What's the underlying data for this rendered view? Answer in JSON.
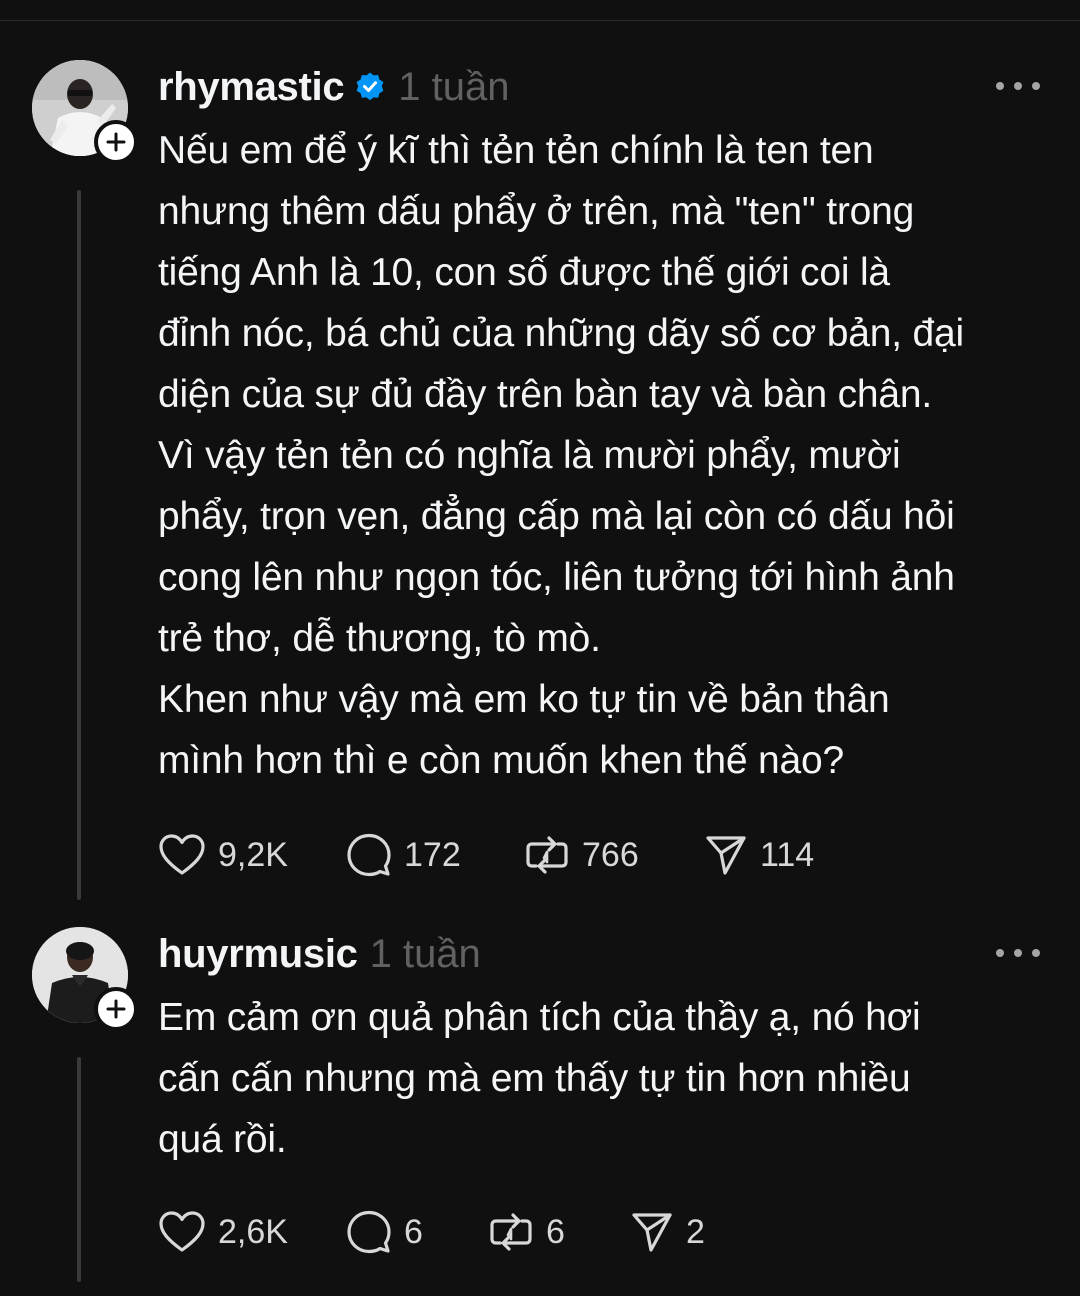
{
  "posts": [
    {
      "username": "rhymastic",
      "verified": true,
      "timestamp": "1 tuần",
      "text": "Nếu em để ý kĩ thì tẻn tẻn chính là ten ten\nnhưng thêm dấu phẩy ở trên, mà \"ten\" trong\ntiếng Anh là 10, con số được thế giới coi là\nđỉnh nóc, bá chủ của những dãy số cơ bản, đại\ndiện của sự đủ đầy trên bàn tay và bàn chân.\nVì vậy tẻn tẻn có nghĩa là mười phẩy, mười\nphẩy, trọn vẹn, đẳng cấp mà lại còn có dấu hỏi\ncong lên như ngọn tóc, liên tưởng tới hình ảnh\ntrẻ thơ, dễ thương, tò mò.\nKhen như vậy mà em ko tự tin về bản thân\nmình hơn thì e còn muốn khen thế nào?",
      "likes": "9,2K",
      "replies": "172",
      "reposts": "766",
      "shares": "114"
    },
    {
      "username": "huyrmusic",
      "verified": false,
      "timestamp": "1 tuần",
      "text": "Em cảm ơn quả phân tích của thầy ạ, nó hơi\ncấn cấn nhưng mà em thấy tự tin hơn nhiều\nquá rồi.",
      "likes": "2,6K",
      "replies": "6",
      "reposts": "6",
      "shares": "2"
    }
  ],
  "icons": {
    "like": "heart-icon",
    "reply": "comment-icon",
    "repost": "repost-icon",
    "share": "send-icon",
    "more": "more-dots-icon",
    "follow": "plus-icon",
    "verified": "verified-badge-icon"
  },
  "colors": {
    "background": "#101010",
    "text": "#f3f5f7",
    "muted": "#616161",
    "verified": "#0095f6",
    "thread_line": "#3a3a3a"
  }
}
